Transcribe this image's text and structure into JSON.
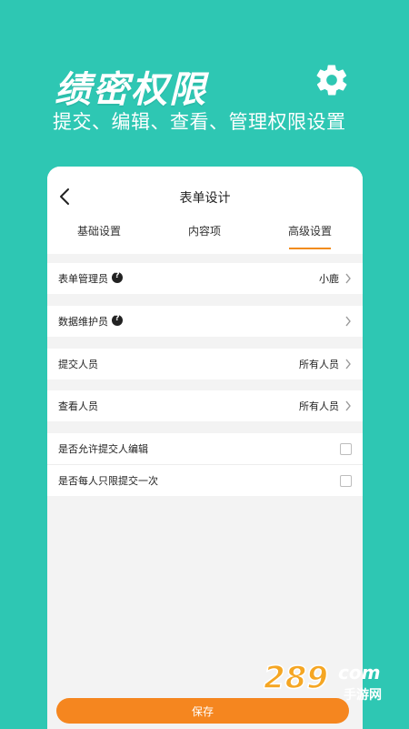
{
  "hero": {
    "title": "绩密权限",
    "subtitle": "提交、编辑、查看、管理权限设置"
  },
  "header": {
    "title": "表单设计"
  },
  "tabs": [
    {
      "label": "基础设置"
    },
    {
      "label": "内容项"
    },
    {
      "label": "高级设置"
    }
  ],
  "rows": {
    "form_admin": {
      "label": "表单管理员",
      "value": "小鹿"
    },
    "data_maintainer": {
      "label": "数据维护员",
      "value": ""
    },
    "submitter": {
      "label": "提交人员",
      "value": "所有人员"
    },
    "viewer": {
      "label": "查看人员",
      "value": "所有人员"
    },
    "allow_edit": {
      "label": "是否允许提交人编辑"
    },
    "once_only": {
      "label": "是否每人只限提交一次"
    }
  },
  "footer": {
    "save_label": "保存"
  },
  "watermark": {
    "brand": "289",
    "domain": "com",
    "caption": "手游网"
  },
  "colors": {
    "background": "#2ec7b3",
    "accent": "#f5861f",
    "tab_active": "#f28c1e"
  },
  "icons": [
    "gear-icon",
    "back-arrow-icon",
    "help-icon",
    "chevron-right-icon",
    "checkbox"
  ]
}
